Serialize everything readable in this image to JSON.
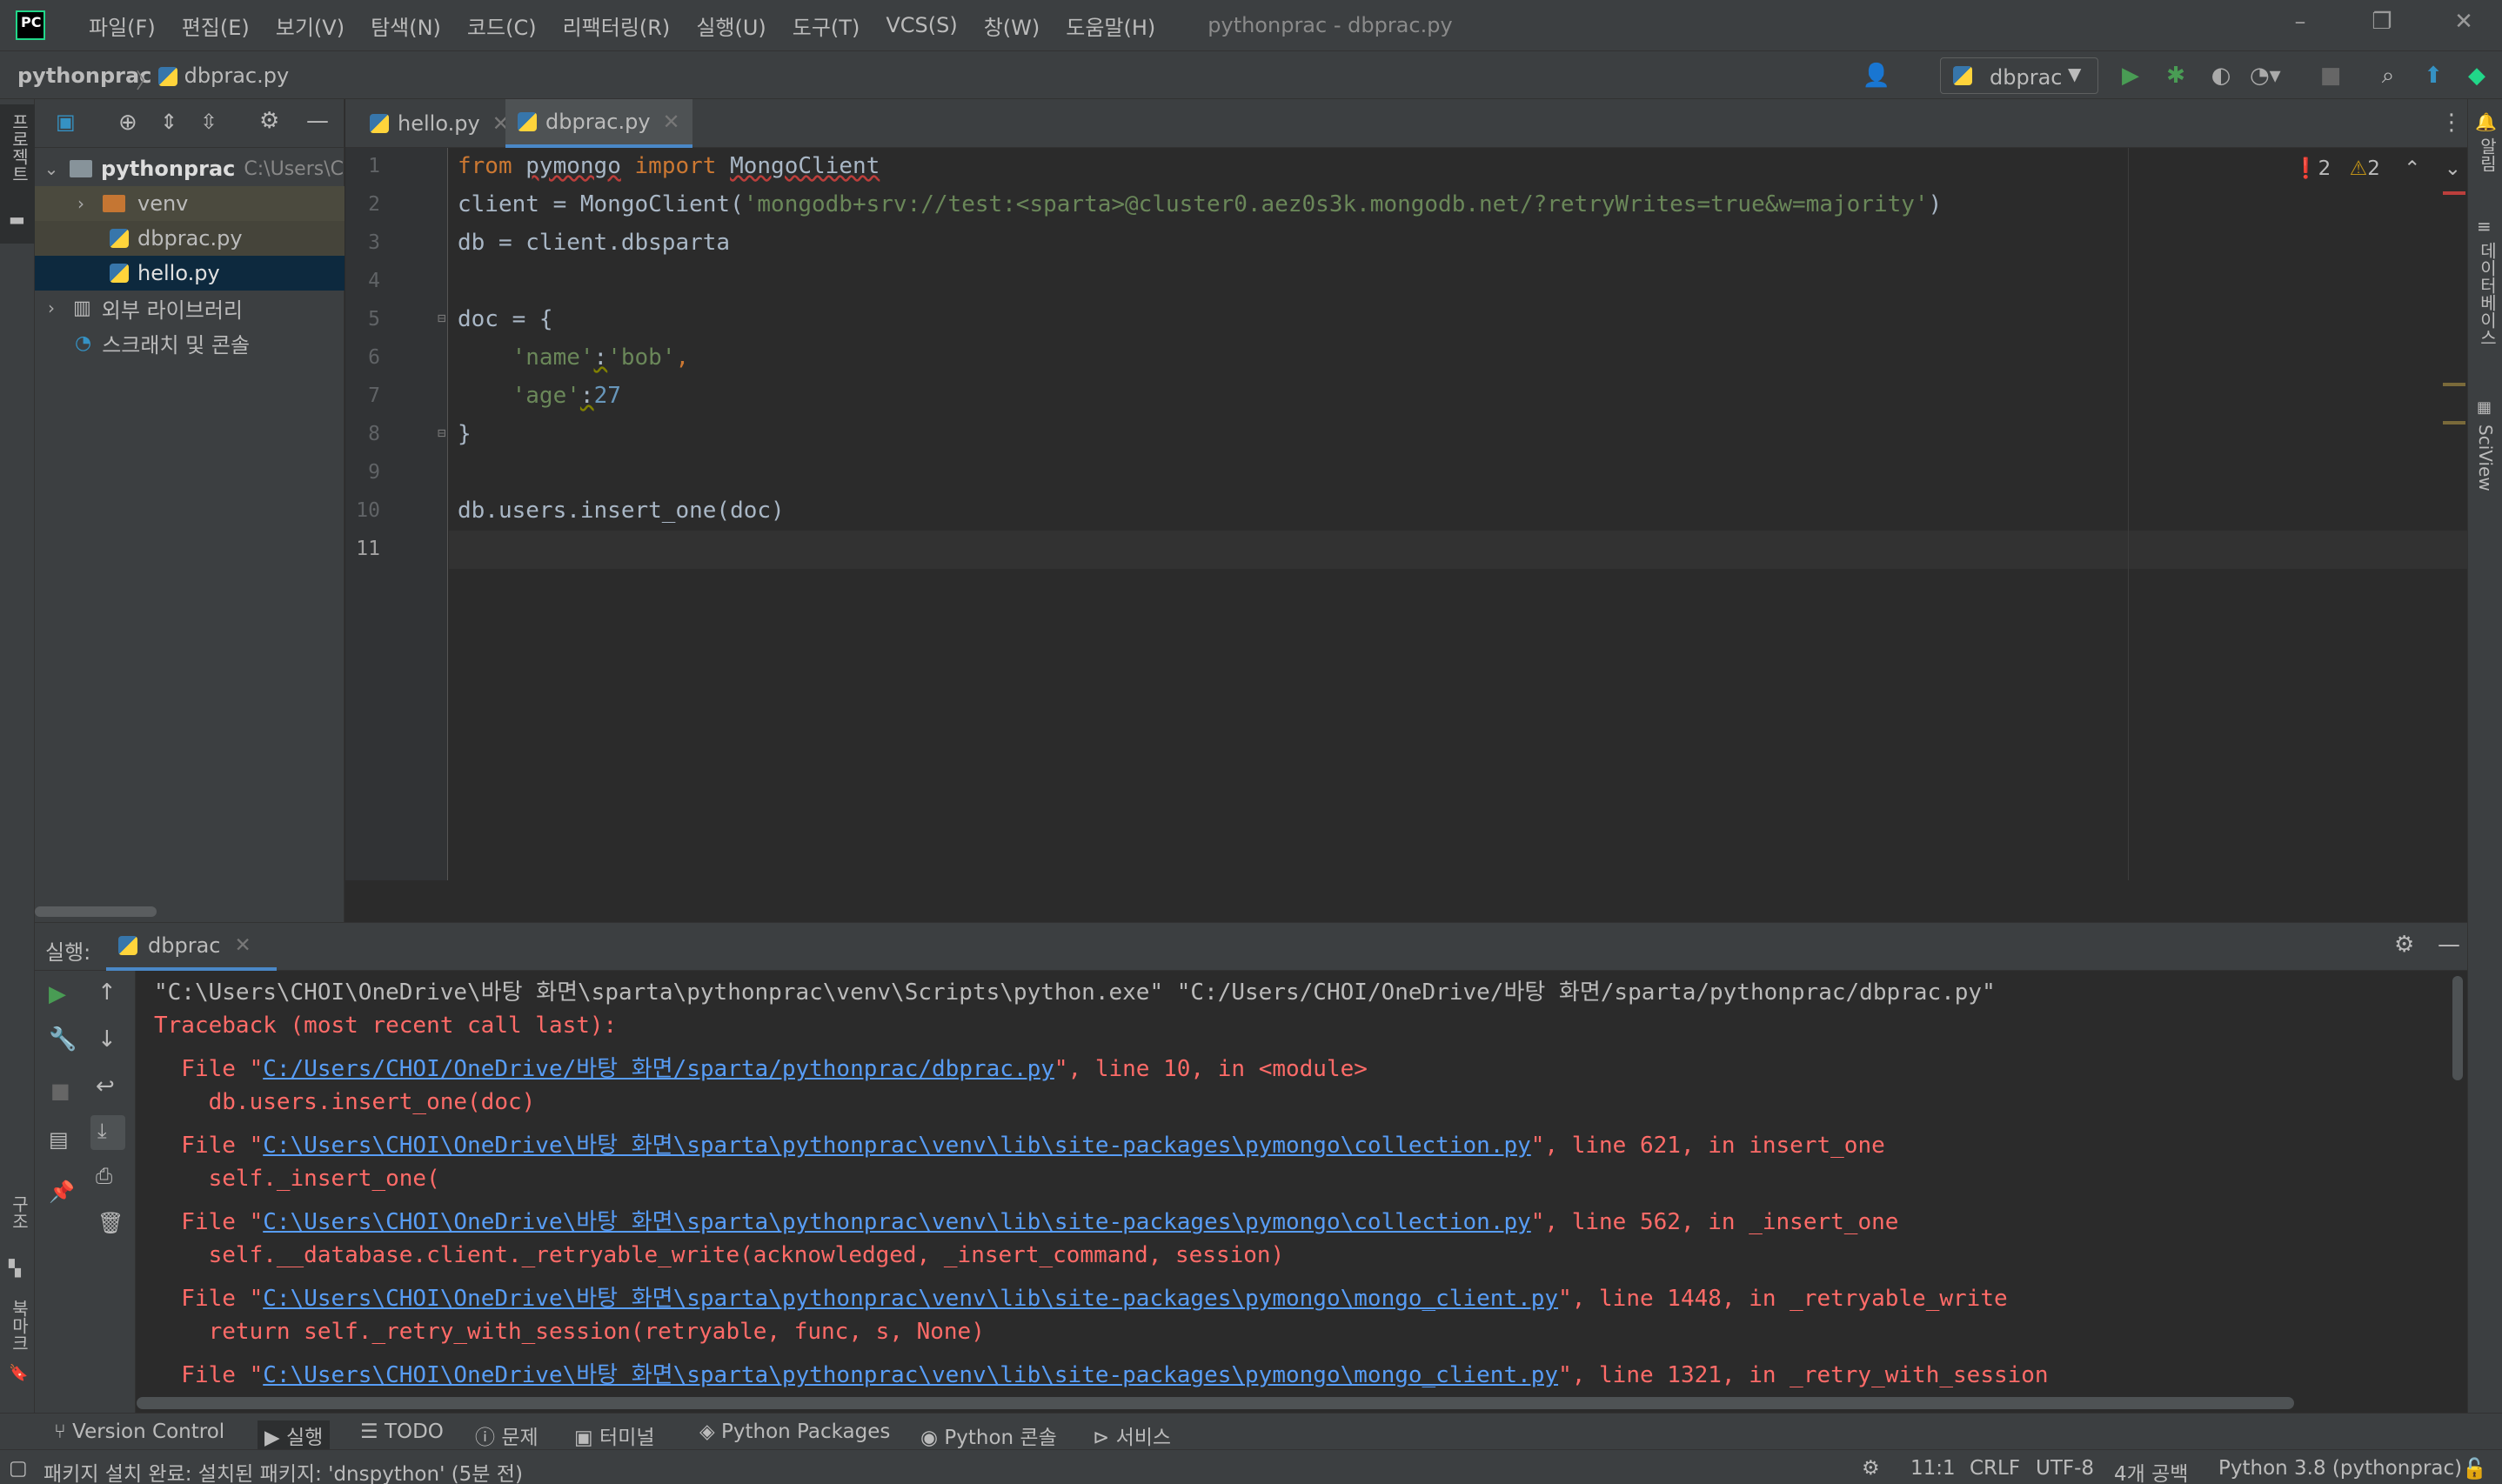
{
  "menu": {
    "items": [
      "파일(F)",
      "편집(E)",
      "보기(V)",
      "탐색(N)",
      "코드(C)",
      "리팩터링(R)",
      "실행(U)",
      "도구(T)",
      "VCS(S)",
      "창(W)",
      "도움말(H)"
    ],
    "window_title": "pythonprac - dbprac.py",
    "logo_text": "PC"
  },
  "breadcrumb": {
    "project": "pythonprac",
    "file": "dbprac.py"
  },
  "toolbar": {
    "run_config": "dbprac"
  },
  "left_stripe": {
    "project_label": "프로젝트",
    "structure_label": "구조",
    "bookmarks_label": "북마크"
  },
  "right_stripe": {
    "notifications_label": "알림",
    "database_label": "데이터베이스",
    "sciview_label": "SciView"
  },
  "project_tree": {
    "root": "pythonprac",
    "root_path": "C:\\Users\\C",
    "venv": "venv",
    "file1": "dbprac.py",
    "file2": "hello.py",
    "external": "외부 라이브러리",
    "scratches": "스크래치 및 콘솔"
  },
  "tabs": [
    {
      "label": "hello.py"
    },
    {
      "label": "dbprac.py"
    }
  ],
  "inspections": {
    "errors": "2",
    "warnings": "2"
  },
  "code_lines": [
    "1",
    "2",
    "3",
    "4",
    "5",
    "6",
    "7",
    "8",
    "9",
    "10",
    "11"
  ],
  "code": {
    "l1_from": "from",
    "l1_mod": "pymongo",
    "l1_import": "import",
    "l1_cls": "MongoClient",
    "l2_pre": "client = MongoClient(",
    "l2_str": "'mongodb+srv://test:<sparta>@cluster0.aez0s3k.mongodb.net/?retryWrites=true&w=majority'",
    "l2_post": ")",
    "l3": "db = client.dbsparta",
    "l5": "doc = {",
    "l6_key": "'name'",
    "l6_colon": ":",
    "l6_val": "'bob'",
    "l6_comma": ",",
    "l7_key": "'age'",
    "l7_colon": ":",
    "l7_val": "27",
    "l8": "}",
    "l10": "db.users.insert_one(doc)"
  },
  "run_panel": {
    "label": "실행:",
    "tab": "dbprac"
  },
  "console": {
    "cmd": "\"C:\\Users\\CHOI\\OneDrive\\바탕 화면\\sparta\\pythonprac\\venv\\Scripts\\python.exe\" \"C:/Users/CHOI/OneDrive/바탕 화면/sparta/pythonprac/dbprac.py\"",
    "tb": "Traceback (most recent call last):",
    "f1_pre": "  File \"",
    "f1_link": "C:/Users/CHOI/OneDrive/바탕 화면/sparta/pythonprac/dbprac.py",
    "f1_post": "\", line 10, in <module>",
    "c1": "    db.users.insert_one(doc)",
    "f2_pre": "  File \"",
    "f2_link": "C:\\Users\\CHOI\\OneDrive\\바탕 화면\\sparta\\pythonprac\\venv\\lib\\site-packages\\pymongo\\collection.py",
    "f2_post": "\", line 621, in insert_one",
    "c2": "    self._insert_one(",
    "f3_pre": "  File \"",
    "f3_link": "C:\\Users\\CHOI\\OneDrive\\바탕 화면\\sparta\\pythonprac\\venv\\lib\\site-packages\\pymongo\\collection.py",
    "f3_post": "\", line 562, in _insert_one",
    "c3": "    self.__database.client._retryable_write(acknowledged, _insert_command, session)",
    "f4_pre": "  File \"",
    "f4_link": "C:\\Users\\CHOI\\OneDrive\\바탕 화면\\sparta\\pythonprac\\venv\\lib\\site-packages\\pymongo\\mongo_client.py",
    "f4_post": "\", line 1448, in _retryable_write",
    "c4": "    return self._retry_with_session(retryable, func, s, None)",
    "f5_pre": "  File \"",
    "f5_link": "C:\\Users\\CHOI\\OneDrive\\바탕 화면\\sparta\\pythonprac\\venv\\lib\\site-packages\\pymongo\\mongo_client.py",
    "f5_post": "\", line 1321, in _retry_with_session"
  },
  "bottom_tabs": [
    "Version Control",
    "실행",
    "TODO",
    "문제",
    "터미널",
    "Python Packages",
    "Python 콘솔",
    "서비스"
  ],
  "status": {
    "message": "패키지 설치 완료: 설치된 패키지: 'dnspython' (5분 전)",
    "position": "11:1",
    "line_sep": "CRLF",
    "encoding": "UTF-8",
    "indent": "4개 공백",
    "interpreter": "Python 3.8 (pythonprac)"
  }
}
